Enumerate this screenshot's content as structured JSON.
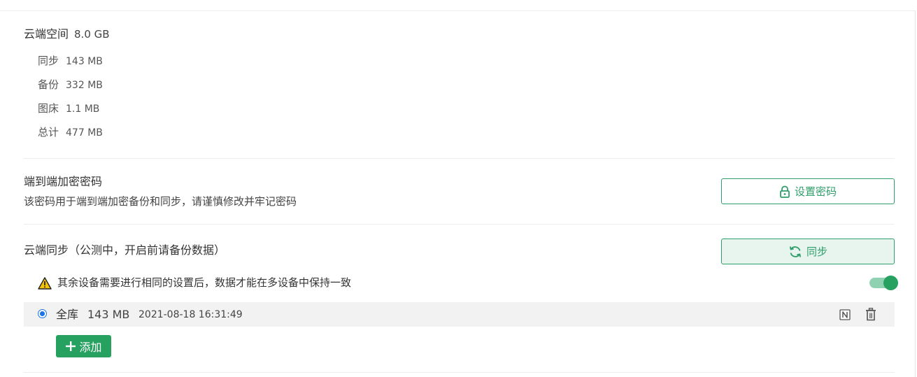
{
  "storage": {
    "title": "云端空间",
    "total_capacity": "8.0 GB",
    "rows": [
      {
        "label": "同步",
        "value": "143 MB"
      },
      {
        "label": "备份",
        "value": "332 MB"
      },
      {
        "label": "图床",
        "value": "1.1 MB"
      },
      {
        "label": "总计",
        "value": "477 MB"
      }
    ]
  },
  "e2e": {
    "title": "端到端加密密码",
    "description": "该密码用于端到端加密备份和同步，请谨慎修改并牢记密码",
    "button_label": "设置密码",
    "button_icon": "lock-icon"
  },
  "cloud_sync": {
    "title": "云端同步（公测中，开启前请备份数据）",
    "button_label": "同步",
    "button_icon": "refresh-icon",
    "warning_text": "其余设备需要进行相同的设置后，数据才能在多设备中保持一致",
    "toggle_on": true,
    "library": {
      "name": "全库",
      "size": "143 MB",
      "timestamp": "2021-08-18 16:31:49",
      "selected": true
    },
    "add_button_label": "添加"
  },
  "colors": {
    "accent": "#27a160",
    "outline": "#2e9e6b",
    "radio": "#1a73e8",
    "warning": "#f5c400"
  }
}
